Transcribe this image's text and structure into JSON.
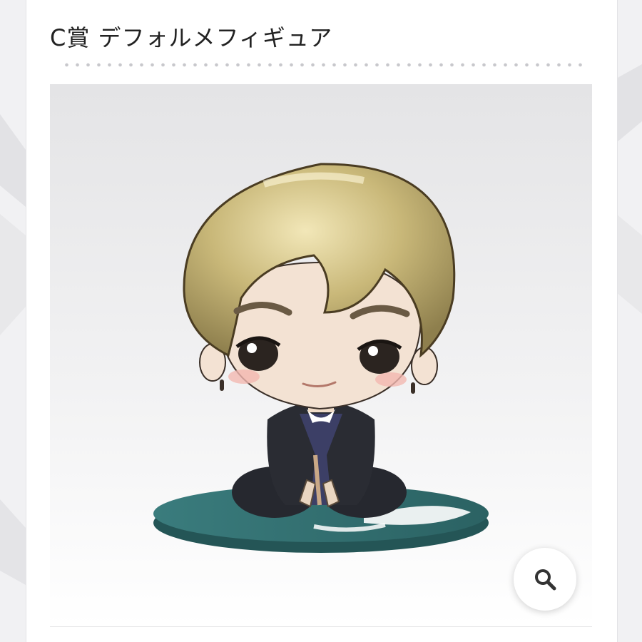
{
  "prize": {
    "title": "C賞 デフォルメフィギュア"
  },
  "product_image": {
    "icon": "chibi-figure-illustration"
  },
  "zoom": {
    "icon": "magnifier-icon"
  },
  "colors": {
    "hair": "#c9b879",
    "base": "#2f6c6d",
    "jacket": "#2a2c33",
    "skin": "#f3e2d3",
    "panel": "#ebebed"
  }
}
